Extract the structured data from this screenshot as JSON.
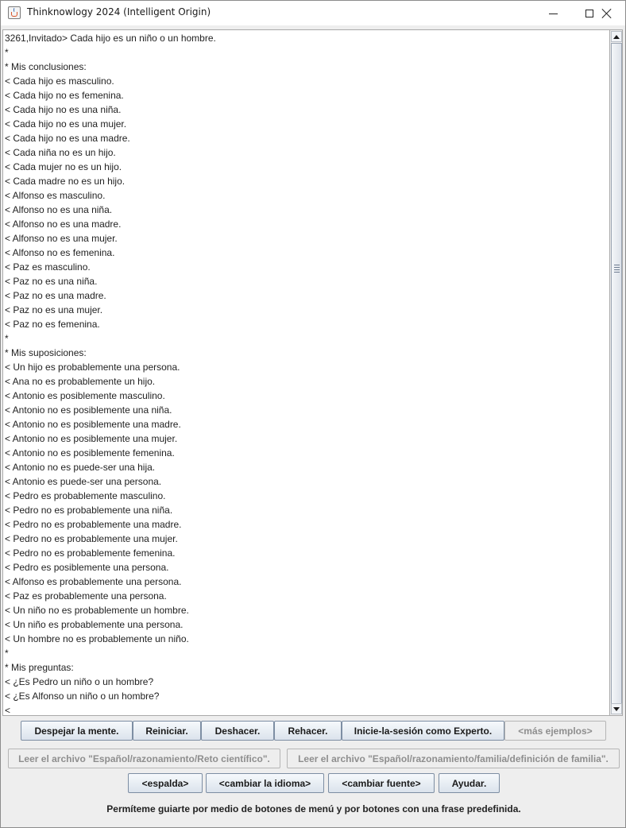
{
  "window": {
    "title": "Thinknowlogy 2024 (Intelligent Origin)",
    "icon": "java-cup-icon"
  },
  "textarea": {
    "lines": [
      "3261,Invitado> Cada hijo es un niño o un hombre.",
      "*",
      "* Mis conclusiones:",
      "< Cada hijo es masculino.",
      "< Cada hijo no es femenina.",
      "< Cada hijo no es una niña.",
      "< Cada hijo no es una mujer.",
      "< Cada hijo no es una madre.",
      "< Cada niña no es un hijo.",
      "< Cada mujer no es un hijo.",
      "< Cada madre no es un hijo.",
      "< Alfonso es masculino.",
      "< Alfonso no es una niña.",
      "< Alfonso no es una madre.",
      "< Alfonso no es una mujer.",
      "< Alfonso no es femenina.",
      "< Paz es masculino.",
      "< Paz no es una niña.",
      "< Paz no es una madre.",
      "< Paz no es una mujer.",
      "< Paz no es femenina.",
      "*",
      "* Mis suposiciones:",
      "< Un hijo es probablemente una persona.",
      "< Ana no es probablemente un hijo.",
      "< Antonio es posiblemente masculino.",
      "< Antonio no es posiblemente una niña.",
      "< Antonio no es posiblemente una madre.",
      "< Antonio no es posiblemente una mujer.",
      "< Antonio no es posiblemente femenina.",
      "< Antonio no es puede-ser una hija.",
      "< Antonio es puede-ser una persona.",
      "< Pedro es probablemente masculino.",
      "< Pedro no es probablemente una niña.",
      "< Pedro no es probablemente una madre.",
      "< Pedro no es probablemente una mujer.",
      "< Pedro no es probablemente femenina.",
      "< Pedro es posiblemente una persona.",
      "< Alfonso es probablemente una persona.",
      "< Paz es probablemente una persona.",
      "< Un niño no es probablemente un hombre.",
      "< Un niño es probablemente una persona.",
      "< Un hombre no es probablemente un niño.",
      "*",
      "* Mis preguntas:",
      "< ¿Es Pedro un niño o un hombre?",
      "< ¿Es Alfonso un niño o un hombre?",
      "<"
    ]
  },
  "buttons": {
    "row1": {
      "clear_mind": "Despejar la mente.",
      "restart": "Reiniciar.",
      "undo": "Deshacer.",
      "redo": "Rehacer.",
      "login_expert": "Inicie-la-sesión como Experto.",
      "more_examples": "<más ejemplos>"
    },
    "row2": {
      "read_scientific": "Leer el archivo \"Español/razonamiento/Reto científico\".",
      "read_family": "Leer el archivo \"Español/razonamiento/familia/definición de familia\"."
    },
    "row3": {
      "back": "<espalda>",
      "change_language": "<cambiar la idioma>",
      "change_font": "<cambiar fuente>",
      "help": "Ayudar."
    }
  },
  "status": {
    "text": "Permíteme guiarte por medio de botones de menú y por botones con una frase predefinida."
  }
}
